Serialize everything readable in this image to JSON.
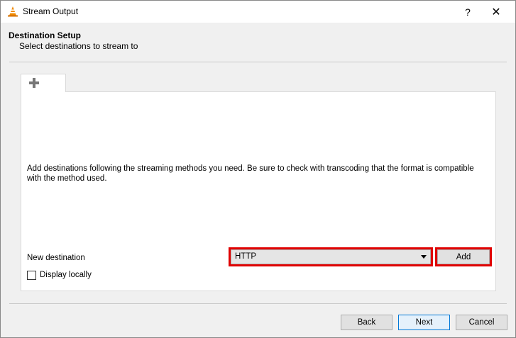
{
  "window": {
    "title": "Stream Output",
    "help_label": "?",
    "close_label": "✕"
  },
  "header": {
    "title": "Destination Setup",
    "subtitle": "Select destinations to stream to"
  },
  "tabs": [
    {
      "icon": "plus-icon"
    }
  ],
  "panel": {
    "info": "Add destinations following the streaming methods you need. Be sure to check with transcoding that the format is compatible with the method used.",
    "new_destination_label": "New destination",
    "destination_value": "HTTP",
    "add_label": "Add",
    "display_locally_label": "Display locally",
    "display_locally_checked": false
  },
  "footer": {
    "back_label": "Back",
    "next_label": "Next",
    "cancel_label": "Cancel"
  },
  "colors": {
    "highlight": "#e00000",
    "accent": "#0078d7"
  }
}
